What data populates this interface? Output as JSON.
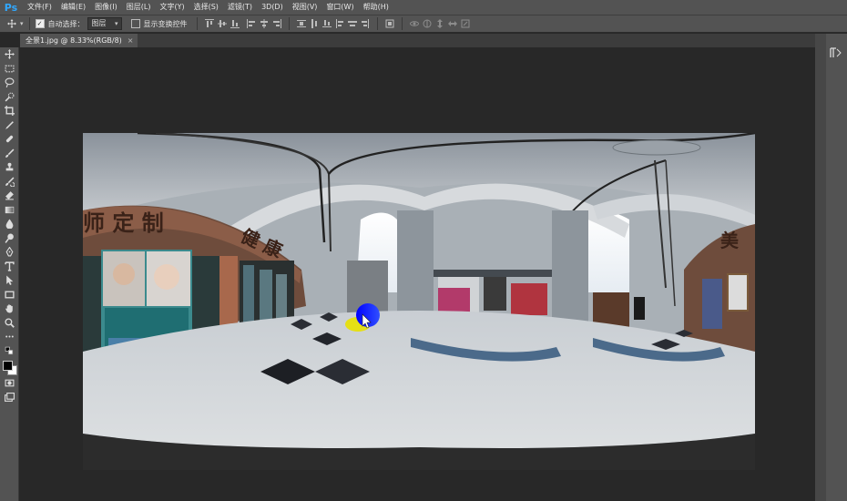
{
  "app": {
    "logo": "Ps"
  },
  "menu": [
    "文件(F)",
    "编辑(E)",
    "图像(I)",
    "图层(L)",
    "文字(Y)",
    "选择(S)",
    "滤镜(T)",
    "3D(D)",
    "视图(V)",
    "窗口(W)",
    "帮助(H)"
  ],
  "options": {
    "auto_select_label": "自动选择：",
    "auto_select_checked": true,
    "auto_select_target": "图层",
    "transform_controls_label": "显示变换控件",
    "transform_controls_checked": false
  },
  "document": {
    "tab_label": "全景1.jpg @ 8.33%(RGB/8)",
    "close_glyph": "×",
    "sign_left": "师 定 制",
    "sign_left2": "健 康",
    "sign_right": "美"
  },
  "tools": [
    "move-tool",
    "marquee-tool",
    "lasso-tool",
    "quick-select-tool",
    "crop-tool",
    "eyedropper-tool",
    "healing-brush-tool",
    "brush-tool",
    "clone-stamp-tool",
    "history-brush-tool",
    "eraser-tool",
    "gradient-tool",
    "blur-tool",
    "dodge-tool",
    "pen-tool",
    "type-tool",
    "path-select-tool",
    "rectangle-tool",
    "hand-tool",
    "zoom-tool",
    "more-tools",
    "default-colors",
    "color-swatches",
    "quick-mask-mode",
    "screen-mode"
  ],
  "colors": {
    "foreground": "#000000",
    "background": "#ffffff",
    "ps_blue": "#31a8ff"
  }
}
